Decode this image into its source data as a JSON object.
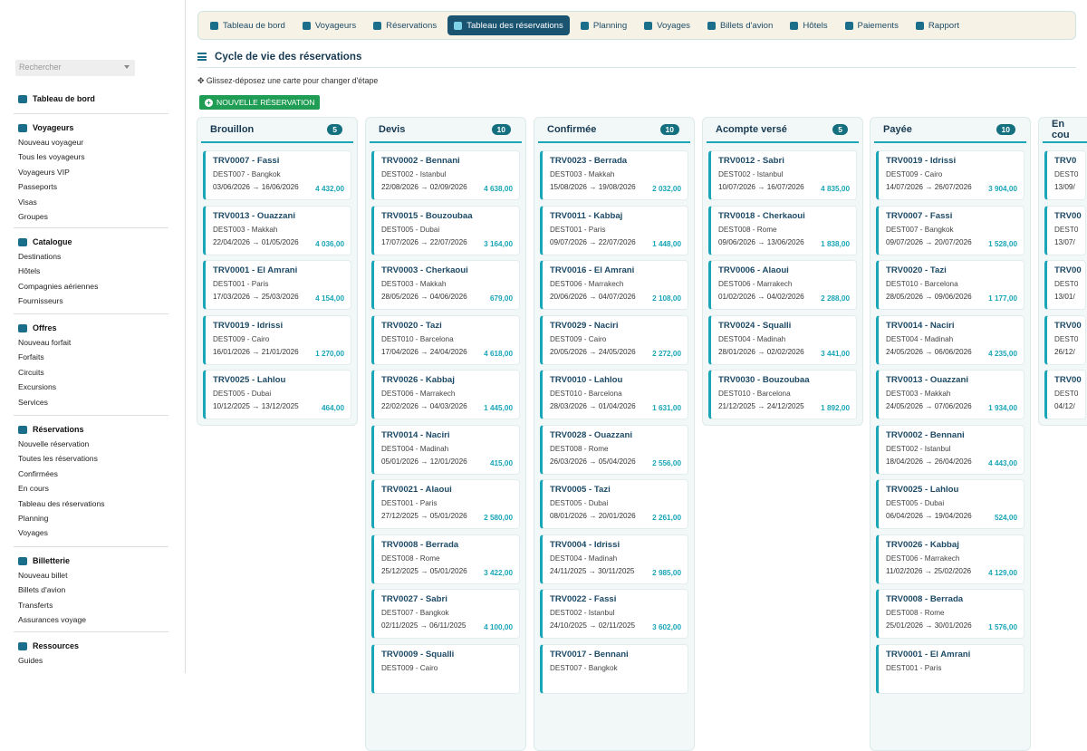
{
  "sidebar": {
    "search_placeholder": "Rechercher",
    "home": "Tableau de bord",
    "sections": [
      {
        "title": "Voyageurs",
        "items": [
          "Nouveau voyageur",
          "Tous les voyageurs",
          "Voyageurs VIP",
          "Passeports",
          "Visas",
          "Groupes"
        ]
      },
      {
        "title": "Catalogue",
        "items": [
          "Destinations",
          "Hôtels",
          "Compagnies aériennes",
          "Fournisseurs"
        ]
      },
      {
        "title": "Offres",
        "items": [
          "Nouveau forfait",
          "Forfaits",
          "Circuits",
          "Excursions",
          "Services"
        ]
      },
      {
        "title": "Réservations",
        "items": [
          "Nouvelle réservation",
          "Toutes les réservations",
          "Confirmées",
          "En cours",
          "Tableau des réservations",
          "Planning",
          "Voyages"
        ]
      },
      {
        "title": "Billetterie",
        "items": [
          "Nouveau billet",
          "Billets d'avion",
          "Transferts",
          "Assurances voyage"
        ]
      },
      {
        "title": "Ressources",
        "items": [
          "Guides"
        ]
      }
    ]
  },
  "topnav": [
    "Tableau de bord",
    "Voyageurs",
    "Réservations",
    "Tableau des réservations",
    "Planning",
    "Voyages",
    "Billets d'avion",
    "Hôtels",
    "Paiements",
    "Rapport"
  ],
  "active_tab": "Tableau des réservations",
  "page": {
    "title": "Cycle de vie des réservations",
    "hint": "Glissez-déposez une carte pour changer d'étape",
    "new_button": "NOUVELLE RÉSERVATION"
  },
  "columns": [
    {
      "name": "Brouillon",
      "count": "5",
      "cards": [
        {
          "ref": "TRV0007 - Fassi",
          "dest": "DEST007 - Bangkok",
          "dates": "03/06/2026 → 16/06/2026",
          "amount": "4 432,00"
        },
        {
          "ref": "TRV0013 - Ouazzani",
          "dest": "DEST003 - Makkah",
          "dates": "22/04/2026 → 01/05/2026",
          "amount": "4 036,00"
        },
        {
          "ref": "TRV0001 - El Amrani",
          "dest": "DEST001 - Paris",
          "dates": "17/03/2026 → 25/03/2026",
          "amount": "4 154,00"
        },
        {
          "ref": "TRV0019 - Idrissi",
          "dest": "DEST009 - Cairo",
          "dates": "16/01/2026 → 21/01/2026",
          "amount": "1 270,00"
        },
        {
          "ref": "TRV0025 - Lahlou",
          "dest": "DEST005 - Dubai",
          "dates": "10/12/2025 → 13/12/2025",
          "amount": "464,00"
        }
      ]
    },
    {
      "name": "Devis",
      "count": "10",
      "cards": [
        {
          "ref": "TRV0002 - Bennani",
          "dest": "DEST002 - Istanbul",
          "dates": "22/08/2026 → 02/09/2026",
          "amount": "4 638,00"
        },
        {
          "ref": "TRV0015 - Bouzoubaa",
          "dest": "DEST005 - Dubai",
          "dates": "17/07/2026 → 22/07/2026",
          "amount": "3 164,00"
        },
        {
          "ref": "TRV0003 - Cherkaoui",
          "dest": "DEST003 - Makkah",
          "dates": "28/05/2026 → 04/06/2026",
          "amount": "679,00"
        },
        {
          "ref": "TRV0020 - Tazi",
          "dest": "DEST010 - Barcelona",
          "dates": "17/04/2026 → 24/04/2026",
          "amount": "4 618,00"
        },
        {
          "ref": "TRV0026 - Kabbaj",
          "dest": "DEST006 - Marrakech",
          "dates": "22/02/2026 → 04/03/2026",
          "amount": "1 445,00"
        },
        {
          "ref": "TRV0014 - Naciri",
          "dest": "DEST004 - Madinah",
          "dates": "05/01/2026 → 12/01/2026",
          "amount": "415,00"
        },
        {
          "ref": "TRV0021 - Alaoui",
          "dest": "DEST001 - Paris",
          "dates": "27/12/2025 → 05/01/2026",
          "amount": "2 580,00"
        },
        {
          "ref": "TRV0008 - Berrada",
          "dest": "DEST008 - Rome",
          "dates": "25/12/2025 → 05/01/2026",
          "amount": "3 422,00"
        },
        {
          "ref": "TRV0027 - Sabri",
          "dest": "DEST007 - Bangkok",
          "dates": "02/11/2025 → 06/11/2025",
          "amount": "4 100,00"
        },
        {
          "ref": "TRV0009 - Squalli",
          "dest": "DEST009 - Cairo",
          "dates": "",
          "amount": ""
        }
      ]
    },
    {
      "name": "Confirmée",
      "count": "10",
      "cards": [
        {
          "ref": "TRV0023 - Berrada",
          "dest": "DEST003 - Makkah",
          "dates": "15/08/2026 → 19/08/2026",
          "amount": "2 032,00"
        },
        {
          "ref": "TRV0011 - Kabbaj",
          "dest": "DEST001 - Paris",
          "dates": "09/07/2026 → 22/07/2026",
          "amount": "1 448,00"
        },
        {
          "ref": "TRV0016 - El Amrani",
          "dest": "DEST006 - Marrakech",
          "dates": "20/06/2026 → 04/07/2026",
          "amount": "2 108,00"
        },
        {
          "ref": "TRV0029 - Naciri",
          "dest": "DEST009 - Cairo",
          "dates": "20/05/2026 → 24/05/2026",
          "amount": "2 272,00"
        },
        {
          "ref": "TRV0010 - Lahlou",
          "dest": "DEST010 - Barcelona",
          "dates": "28/03/2026 → 01/04/2026",
          "amount": "1 631,00"
        },
        {
          "ref": "TRV0028 - Ouazzani",
          "dest": "DEST008 - Rome",
          "dates": "26/03/2026 → 05/04/2026",
          "amount": "2 556,00"
        },
        {
          "ref": "TRV0005 - Tazi",
          "dest": "DEST005 - Dubai",
          "dates": "08/01/2026 → 20/01/2026",
          "amount": "2 261,00"
        },
        {
          "ref": "TRV0004 - Idrissi",
          "dest": "DEST004 - Madinah",
          "dates": "24/11/2025 → 30/11/2025",
          "amount": "2 985,00"
        },
        {
          "ref": "TRV0022 - Fassi",
          "dest": "DEST002 - Istanbul",
          "dates": "24/10/2025 → 02/11/2025",
          "amount": "3 602,00"
        },
        {
          "ref": "TRV0017 - Bennani",
          "dest": "DEST007 - Bangkok",
          "dates": "",
          "amount": ""
        }
      ]
    },
    {
      "name": "Acompte versé",
      "count": "5",
      "cards": [
        {
          "ref": "TRV0012 - Sabri",
          "dest": "DEST002 - Istanbul",
          "dates": "10/07/2026 → 16/07/2026",
          "amount": "4 835,00"
        },
        {
          "ref": "TRV0018 - Cherkaoui",
          "dest": "DEST008 - Rome",
          "dates": "09/06/2026 → 13/06/2026",
          "amount": "1 838,00"
        },
        {
          "ref": "TRV0006 - Alaoui",
          "dest": "DEST006 - Marrakech",
          "dates": "01/02/2026 → 04/02/2026",
          "amount": "2 288,00"
        },
        {
          "ref": "TRV0024 - Squalli",
          "dest": "DEST004 - Madinah",
          "dates": "28/01/2026 → 02/02/2026",
          "amount": "3 441,00"
        },
        {
          "ref": "TRV0030 - Bouzoubaa",
          "dest": "DEST010 - Barcelona",
          "dates": "21/12/2025 → 24/12/2025",
          "amount": "1 892,00"
        }
      ]
    },
    {
      "name": "Payée",
      "count": "10",
      "cards": [
        {
          "ref": "TRV0019 - Idrissi",
          "dest": "DEST009 - Cairo",
          "dates": "14/07/2026 → 26/07/2026",
          "amount": "3 904,00"
        },
        {
          "ref": "TRV0007 - Fassi",
          "dest": "DEST007 - Bangkok",
          "dates": "09/07/2026 → 20/07/2026",
          "amount": "1 528,00"
        },
        {
          "ref": "TRV0020 - Tazi",
          "dest": "DEST010 - Barcelona",
          "dates": "28/05/2026 → 09/06/2026",
          "amount": "1 177,00"
        },
        {
          "ref": "TRV0014 - Naciri",
          "dest": "DEST004 - Madinah",
          "dates": "24/05/2026 → 06/06/2026",
          "amount": "4 235,00"
        },
        {
          "ref": "TRV0013 - Ouazzani",
          "dest": "DEST003 - Makkah",
          "dates": "24/05/2026 → 07/06/2026",
          "amount": "1 934,00"
        },
        {
          "ref": "TRV0002 - Bennani",
          "dest": "DEST002 - Istanbul",
          "dates": "18/04/2026 → 26/04/2026",
          "amount": "4 443,00"
        },
        {
          "ref": "TRV0025 - Lahlou",
          "dest": "DEST005 - Dubai",
          "dates": "06/04/2026 → 19/04/2026",
          "amount": "524,00"
        },
        {
          "ref": "TRV0026 - Kabbaj",
          "dest": "DEST006 - Marrakech",
          "dates": "11/02/2026 → 25/02/2026",
          "amount": "4 129,00"
        },
        {
          "ref": "TRV0008 - Berrada",
          "dest": "DEST008 - Rome",
          "dates": "25/01/2026 → 30/01/2026",
          "amount": "1 576,00"
        },
        {
          "ref": "TRV0001 - El Amrani",
          "dest": "DEST001 - Paris",
          "dates": "",
          "amount": ""
        }
      ]
    },
    {
      "name": "En cou",
      "count": "",
      "cards": [
        {
          "ref": "TRV0",
          "dest": "DEST0",
          "dates": "13/09/",
          "amount": ""
        },
        {
          "ref": "TRV00",
          "dest": "DEST0",
          "dates": "13/07/",
          "amount": ""
        },
        {
          "ref": "TRV00",
          "dest": "DEST0",
          "dates": "13/01/",
          "amount": ""
        },
        {
          "ref": "TRV00",
          "dest": "DEST0",
          "dates": "26/12/",
          "amount": ""
        },
        {
          "ref": "TRV00",
          "dest": "DEST0",
          "dates": "04/12/",
          "amount": ""
        }
      ]
    }
  ]
}
